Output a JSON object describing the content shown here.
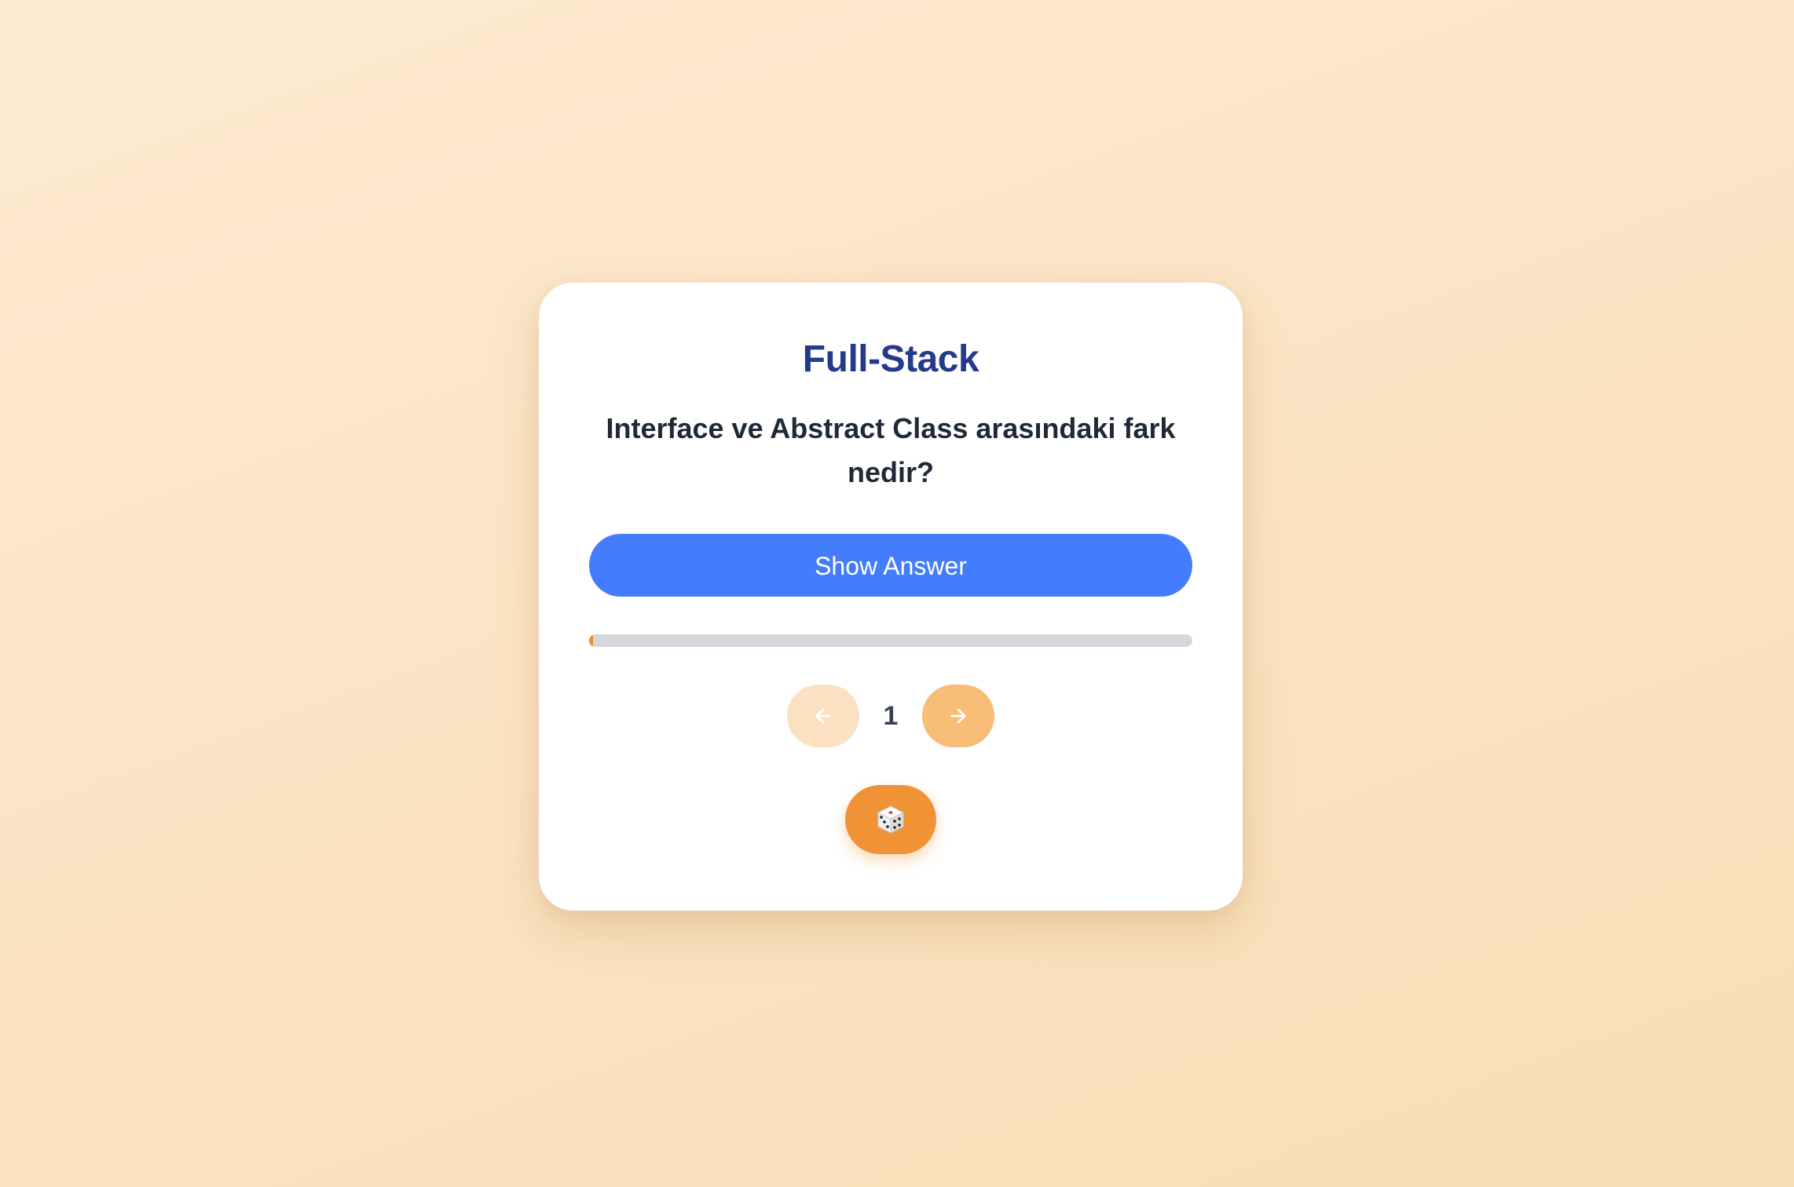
{
  "card": {
    "title": "Full-Stack",
    "question": "Interface ve Abstract Class arasındaki fark nedir?",
    "show_answer_label": "Show Answer"
  },
  "progress": {
    "value_percent": 0.6
  },
  "pagination": {
    "current_page": "1",
    "prev_icon": "arrow-left-icon",
    "next_icon": "arrow-right-icon"
  },
  "random_button": {
    "icon": "dice-icon"
  },
  "colors": {
    "title": "#243a8a",
    "primary_button": "#447dfb",
    "accent": "#f28c28",
    "prev_button_bg": "#fbe1c1",
    "next_button_bg": "#f8bd77",
    "dice_button_bg": "#f29236"
  }
}
